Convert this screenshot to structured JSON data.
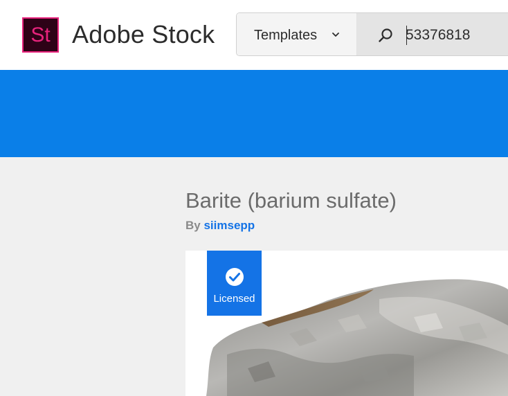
{
  "header": {
    "logo_text": "St",
    "brand": "Adobe Stock",
    "colors": {
      "logo_bg": "#2e0217",
      "logo_accent": "#e8237c"
    }
  },
  "search": {
    "category": "Templates",
    "query": "53376818",
    "icons": {
      "search": "search-icon",
      "dropdown": "chevron-down-icon"
    }
  },
  "banner": {
    "color": "#0a7fe8"
  },
  "asset": {
    "title": "Barite (barium sulfate)",
    "by_label": "By",
    "author": "siimsepp",
    "licensed_badge": "Licensed",
    "colors": {
      "badge": "#1473e6",
      "link": "#1473e6"
    }
  }
}
